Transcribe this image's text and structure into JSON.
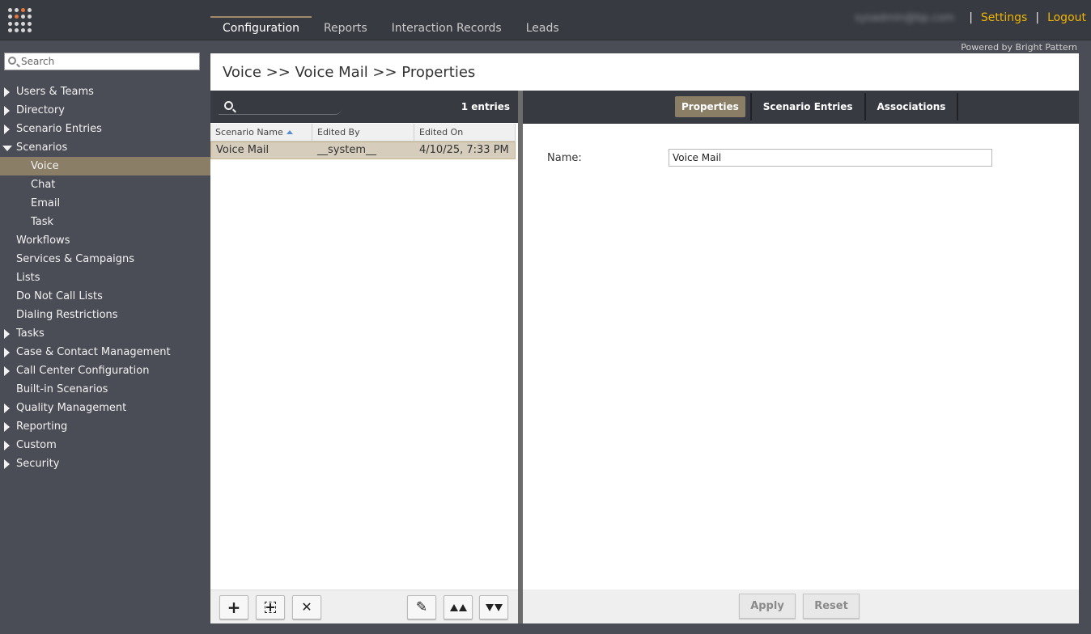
{
  "topnav": {
    "items": [
      "Configuration",
      "Reports",
      "Interaction Records",
      "Leads"
    ],
    "active": "Configuration"
  },
  "user": {
    "email": "sysadmin@bp.com",
    "settings_label": "Settings",
    "logout_label": "Logout",
    "separator": "|"
  },
  "powered_by": "Powered by Bright Pattern",
  "sidebar": {
    "search_placeholder": "Search",
    "items": [
      {
        "label": "Users & Teams",
        "expander": "collapsed"
      },
      {
        "label": "Directory",
        "expander": "collapsed"
      },
      {
        "label": "Scenario Entries",
        "expander": "collapsed"
      },
      {
        "label": "Scenarios",
        "expander": "expanded"
      },
      {
        "label": "Voice",
        "sub": true,
        "selected": true
      },
      {
        "label": "Chat",
        "sub": true
      },
      {
        "label": "Email",
        "sub": true
      },
      {
        "label": "Task",
        "sub": true
      },
      {
        "label": "Workflows"
      },
      {
        "label": "Services & Campaigns"
      },
      {
        "label": "Lists"
      },
      {
        "label": "Do Not Call Lists"
      },
      {
        "label": "Dialing Restrictions"
      },
      {
        "label": "Tasks",
        "expander": "collapsed"
      },
      {
        "label": "Case & Contact Management",
        "expander": "collapsed"
      },
      {
        "label": "Call Center Configuration",
        "expander": "collapsed"
      },
      {
        "label": "Built-in Scenarios"
      },
      {
        "label": "Quality Management",
        "expander": "collapsed"
      },
      {
        "label": "Reporting",
        "expander": "collapsed"
      },
      {
        "label": "Custom",
        "expander": "collapsed"
      },
      {
        "label": "Security",
        "expander": "collapsed"
      }
    ]
  },
  "page": {
    "title": "Voice >> Voice Mail >> Properties"
  },
  "list": {
    "entries_count": "1 entries",
    "columns": [
      "Scenario Name",
      "Edited By",
      "Edited On"
    ],
    "rows": [
      {
        "name": "Voice Mail",
        "edited_by": "__system__",
        "edited_on": "4/10/25, 7:33 PM"
      }
    ],
    "toolbar_icons": [
      "add-icon",
      "add-copy-icon",
      "delete-icon",
      "edit-icon",
      "move-to-top-icon",
      "move-to-bottom-icon"
    ],
    "toolbar_glyphs": {
      "add": "+",
      "delete": "✕",
      "edit": "✎",
      "top": "⏫",
      "bottom": "⏬"
    }
  },
  "detail": {
    "tabs": [
      "Properties",
      "Scenario Entries",
      "Associations"
    ],
    "active_tab": "Properties",
    "name_label": "Name:",
    "name_value": "Voice Mail",
    "apply_label": "Apply",
    "reset_label": "Reset"
  },
  "colors": {
    "topbar": "#373a41",
    "sidebar": "#4a4d55",
    "selected": "#8b7e67",
    "link_accent": "#f0b400",
    "logo_accent": "#e5763a"
  }
}
